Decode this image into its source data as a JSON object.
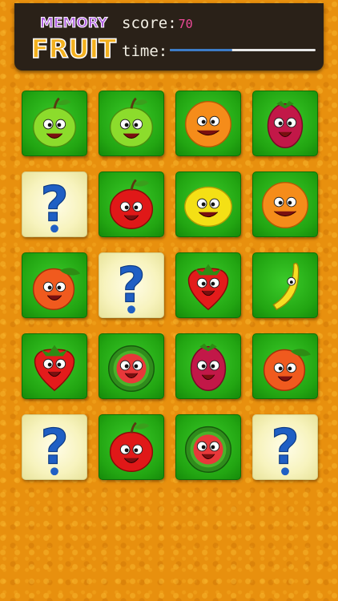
{
  "logo": {
    "line1": "MEMORY",
    "line2": "FRUIT"
  },
  "hud": {
    "score_label": "score:",
    "score_value": "70",
    "time_label": "time:",
    "time_remaining_fraction": 0.43
  },
  "colors": {
    "background": "#e8900e",
    "header": "#2a2118",
    "card_face": "#22a512",
    "card_back": "#f7f3bd",
    "score_value": "#f04a9a",
    "time_fill": "#3d7cc7"
  },
  "board": {
    "columns": 4,
    "rows": 5,
    "cards": [
      [
        "apple-green",
        "apple-green",
        "orange",
        "raspberry"
      ],
      [
        "hidden",
        "apple-red",
        "lemon",
        "orange"
      ],
      [
        "peach",
        "hidden",
        "strawberry",
        "banana"
      ],
      [
        "strawberry",
        "watermelon",
        "raspberry",
        "peach"
      ],
      [
        "hidden",
        "apple-red",
        "watermelon",
        "hidden"
      ]
    ]
  }
}
